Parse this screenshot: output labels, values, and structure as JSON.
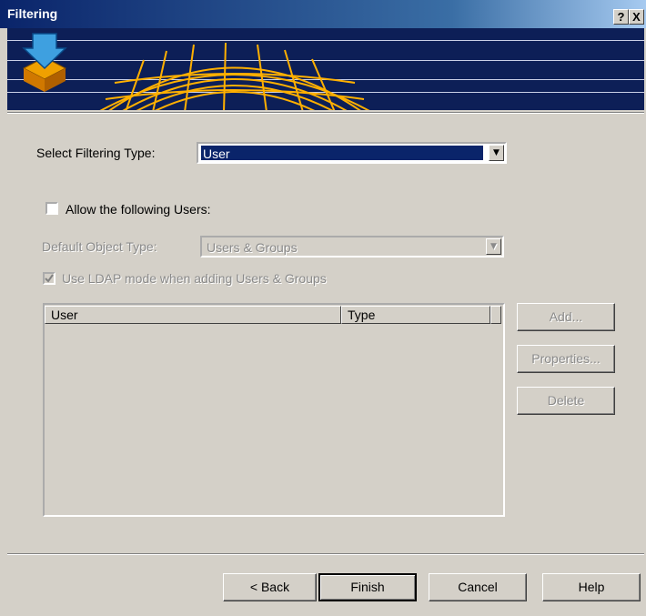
{
  "window": {
    "title": "Filtering",
    "help_btn": "?",
    "close_btn": "X"
  },
  "filter_type": {
    "label": "Select Filtering Type:",
    "value": "User"
  },
  "allow_users": {
    "label": "Allow the following Users:",
    "checked": false
  },
  "default_object": {
    "label": "Default Object Type:",
    "value": "Users & Groups"
  },
  "ldap": {
    "label": "Use LDAP mode when adding Users & Groups",
    "checked": true
  },
  "list": {
    "columns": [
      "User",
      "Type"
    ],
    "rows": []
  },
  "side_buttons": {
    "add": "Add...",
    "properties": "Properties...",
    "delete": "Delete"
  },
  "footer": {
    "back": "< Back",
    "finish": "Finish",
    "cancel": "Cancel",
    "help": "Help"
  },
  "colors": {
    "title_bar": "#0a246a",
    "banner": "#0d1f57",
    "globe": "#ffb000",
    "selection": "#0a246a"
  }
}
